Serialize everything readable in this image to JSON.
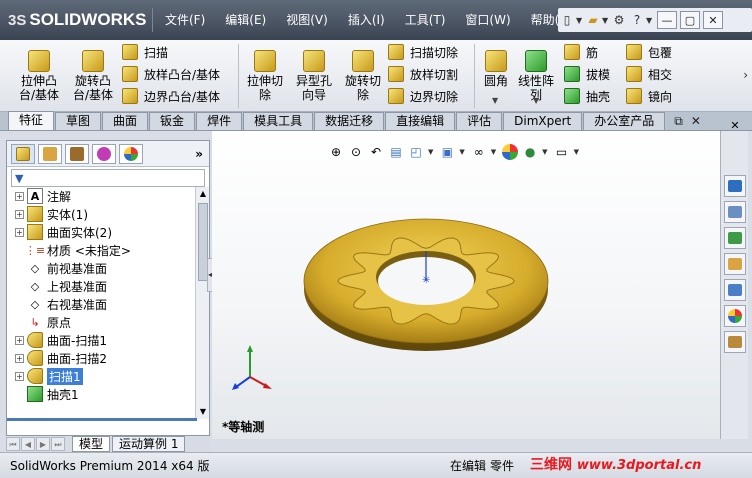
{
  "app": {
    "logo_ds": "3S",
    "logo_text": "SOLIDWORKS"
  },
  "menu": [
    "文件(F)",
    "编辑(E)",
    "视图(V)",
    "插入(I)",
    "工具(T)",
    "窗口(W)",
    "帮助(H)"
  ],
  "window_buttons": [
    "—",
    "▢",
    "✕"
  ],
  "ribbon": {
    "extrude_boss": "拉伸凸\n台/基体",
    "revolve_boss": "旋转凸\n台/基体",
    "sweep": "扫描",
    "loft_boss": "放样凸台/基体",
    "boundary_boss": "边界凸台/基体",
    "extrude_cut": "拉伸切\n除",
    "hole_wizard": "异型孔\n向导",
    "revolve_cut": "旋转切\n除",
    "swept_cut": "扫描切除",
    "lofted_cut": "放样切割",
    "boundary_cut": "边界切除",
    "fillet": "圆角",
    "linear_pattern": "线性阵\n列",
    "rib": "筋",
    "draft": "拔模",
    "shell": "抽壳",
    "wrap": "包覆",
    "intersect": "相交",
    "mirror": "镜向"
  },
  "cm_tabs": [
    "特征",
    "草图",
    "曲面",
    "钣金",
    "焊件",
    "模具工具",
    "数据迁移",
    "直接编辑",
    "评估",
    "DimXpert",
    "办公室产品"
  ],
  "tree": [
    {
      "label": "注解",
      "icon": "annotation-icon",
      "exp": true
    },
    {
      "label": "实体(1)",
      "icon": "solid-body-icon",
      "exp": true
    },
    {
      "label": "曲面实体(2)",
      "icon": "surface-body-icon",
      "exp": true
    },
    {
      "label": "材质 <未指定>",
      "icon": "material-icon",
      "exp": false
    },
    {
      "label": "前视基准面",
      "icon": "plane-icon",
      "exp": false
    },
    {
      "label": "上视基准面",
      "icon": "plane-icon",
      "exp": false
    },
    {
      "label": "右视基准面",
      "icon": "plane-icon",
      "exp": false
    },
    {
      "label": "原点",
      "icon": "origin-icon",
      "exp": false
    },
    {
      "label": "曲面-扫描1",
      "icon": "surface-sweep-icon",
      "exp": true
    },
    {
      "label": "曲面-扫描2",
      "icon": "surface-sweep-icon",
      "exp": true
    },
    {
      "label": "扫描1",
      "icon": "sweep-icon",
      "exp": true,
      "selected": true
    },
    {
      "label": "抽壳1",
      "icon": "shell-icon",
      "exp": false
    }
  ],
  "bottom_tabs": [
    "模型",
    "运动算例 1"
  ],
  "viewport": {
    "view_label": "*等轴测"
  },
  "status": {
    "product": "SolidWorks Premium 2014 x64 版",
    "editing": "在编辑",
    "doc_type": "零件",
    "watermark_cn": "三维网",
    "watermark_url": "www.3dportal.cn"
  },
  "colors": {
    "part_gold": "#c9a227",
    "part_shadow": "#7a5f10",
    "selection": "#3d7fd6"
  }
}
